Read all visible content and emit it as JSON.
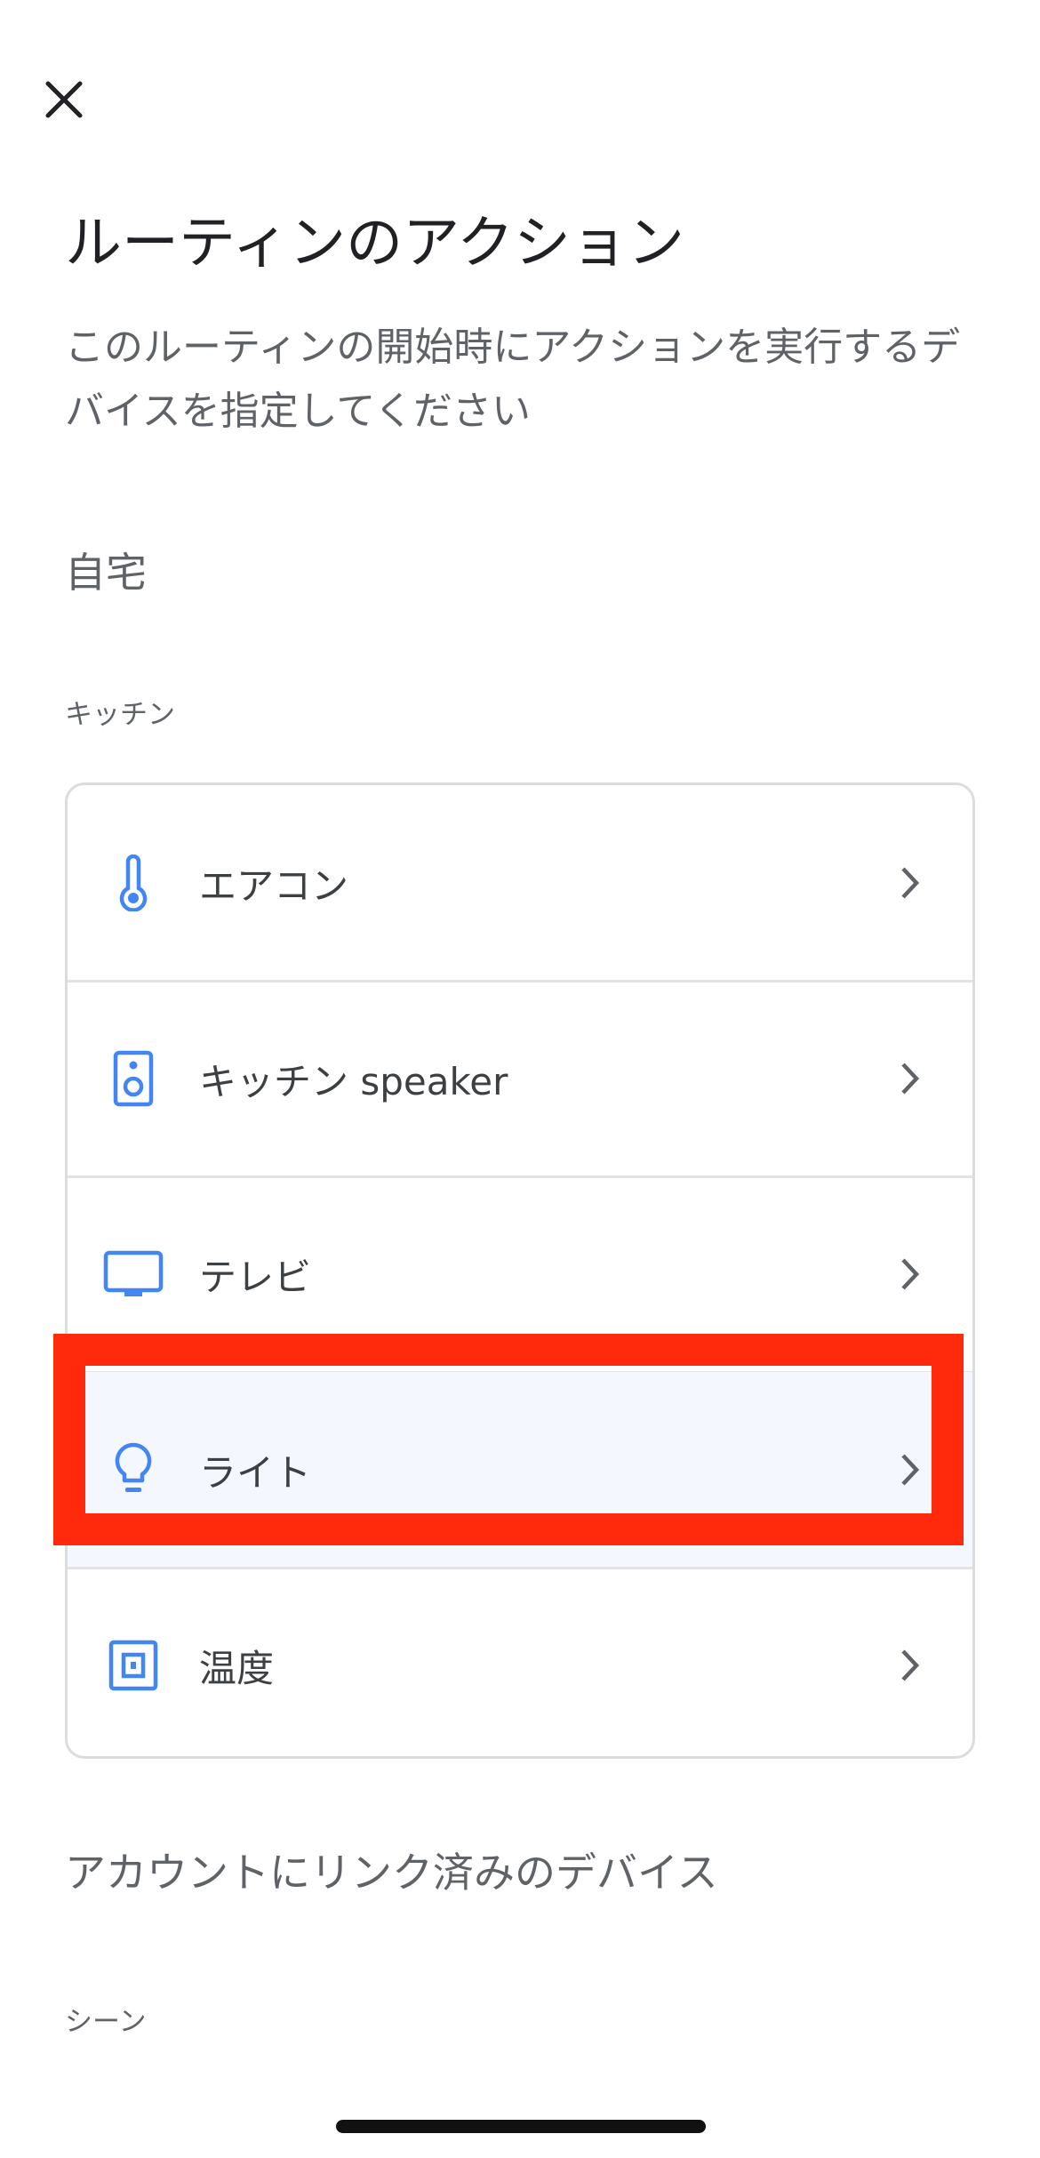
{
  "header": {
    "close_icon": "close-icon",
    "title": "ルーティンのアクション"
  },
  "description": "このルーティンの開始時にアクションを実行するデバイスを指定してください",
  "home": {
    "label": "自宅"
  },
  "room": {
    "label": "キッチン"
  },
  "devices": [
    {
      "label": "エアコン",
      "icon": "thermometer-icon"
    },
    {
      "label": "キッチン speaker",
      "icon": "speaker-icon"
    },
    {
      "label": "テレビ",
      "icon": "tv-icon"
    },
    {
      "label": "ライト",
      "icon": "lightbulb-icon"
    },
    {
      "label": "温度",
      "icon": "thermostat-icon"
    }
  ],
  "linked_section": {
    "label": "アカウントにリンク済みのデバイス"
  },
  "scene": {
    "label": "シーン"
  },
  "colors": {
    "accent": "#4285f4",
    "highlight": "#ff2a0b",
    "chevron": "#5f6368"
  }
}
